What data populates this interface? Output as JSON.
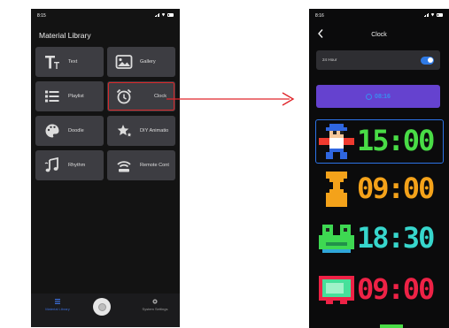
{
  "left_screen": {
    "status_time": "8:15",
    "title": "Material Library",
    "tiles": [
      {
        "label": "Text",
        "icon": "text-icon"
      },
      {
        "label": "Gallery",
        "icon": "gallery-icon"
      },
      {
        "label": "Playlist",
        "icon": "playlist-icon"
      },
      {
        "label": "Clock",
        "icon": "alarm-clock-icon",
        "highlighted": true
      },
      {
        "label": "Doodle",
        "icon": "palette-icon"
      },
      {
        "label": "DIY Animatio",
        "icon": "sparkle-star-icon"
      },
      {
        "label": "Rhythm",
        "icon": "music-note-icon"
      },
      {
        "label": "Remote Cont",
        "icon": "remote-signal-icon"
      }
    ],
    "bottom_nav": {
      "material_library": "Material Library",
      "system_settings": "System Settings"
    }
  },
  "right_screen": {
    "status_time": "8:16",
    "title": "Clock",
    "hour24_label": "24 Hour",
    "hour24_on": true,
    "time_button": "08:16",
    "presets": [
      {
        "time": "15:00",
        "color": "#49dc46",
        "icon": "pixel-character-icon",
        "selected": true
      },
      {
        "time": "09:00",
        "color": "#f4a21a",
        "icon": "hourglass-icon",
        "selected": false
      },
      {
        "time": "18:30",
        "color": "#37d6cc",
        "icon": "pixel-frog-icon",
        "selected": false
      },
      {
        "time": "09:00",
        "color": "#ee2246",
        "icon": "pixel-tv-icon",
        "selected": false
      }
    ]
  },
  "colors": {
    "highlight_red": "#d7282a",
    "accent_blue": "#2c73e6",
    "purple_button": "#6542cf"
  }
}
